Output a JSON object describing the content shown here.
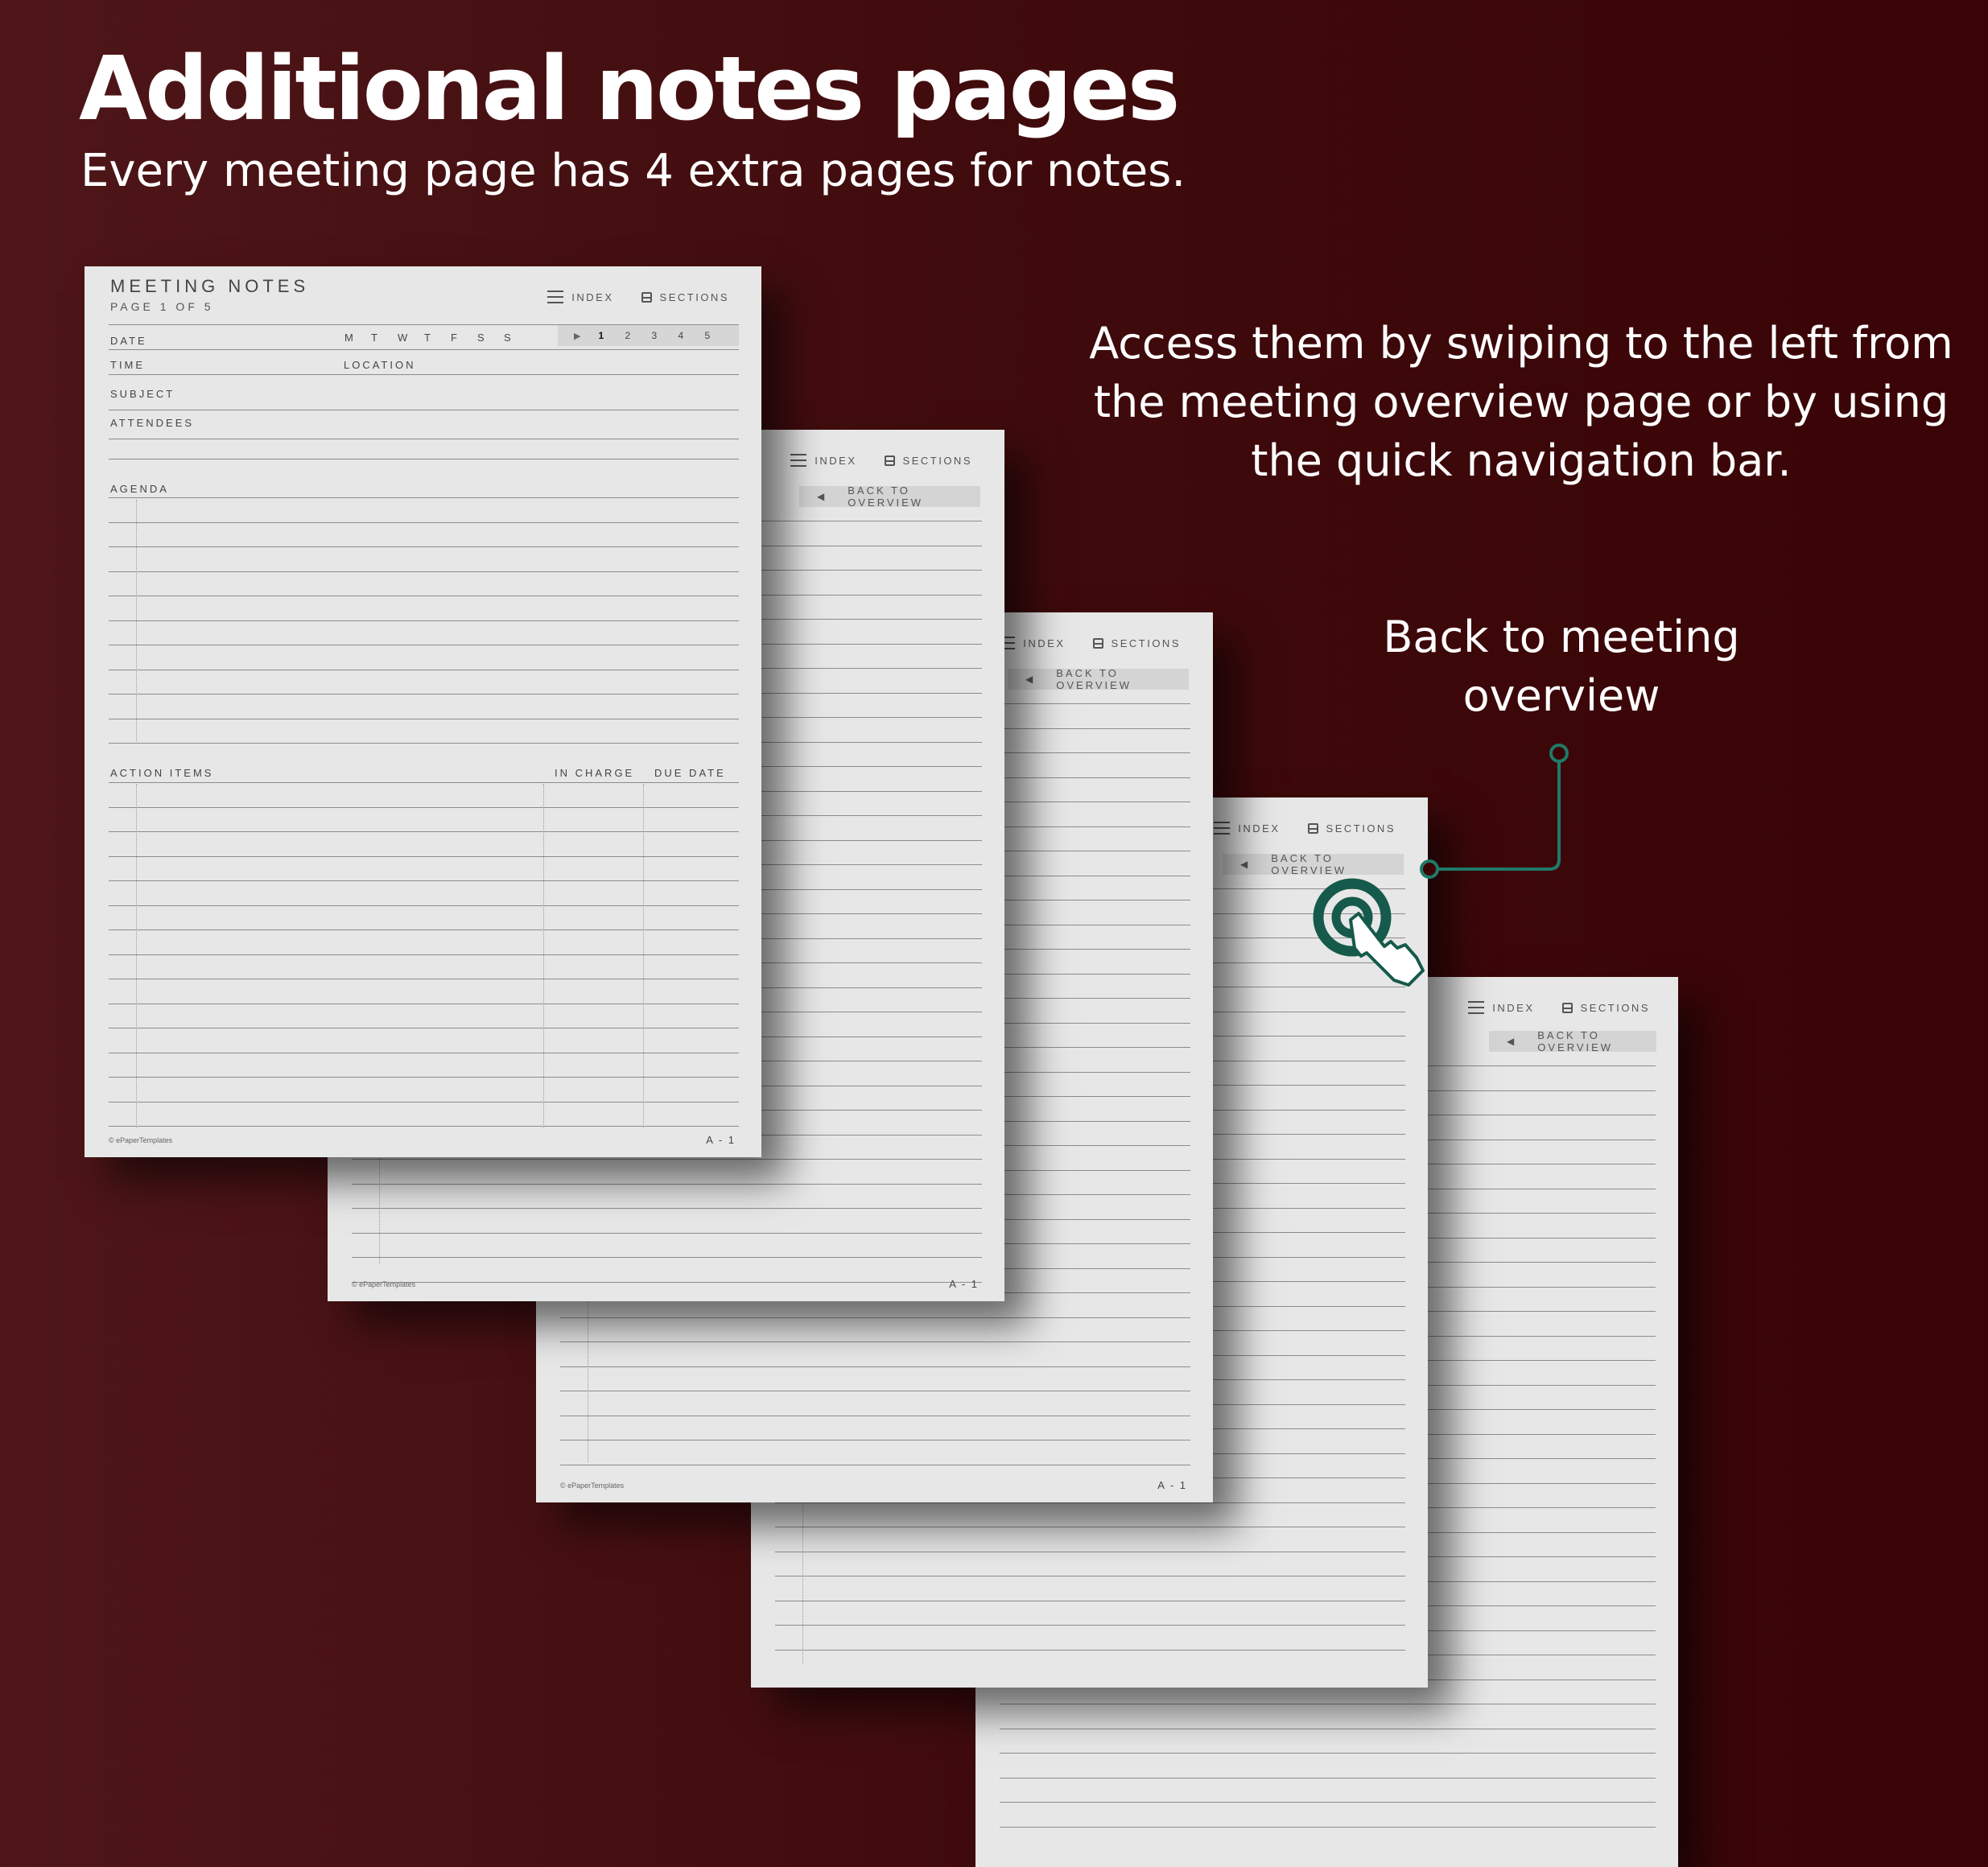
{
  "heading": {
    "title": "Additional notes pages",
    "subtitle": "Every meeting page has 4 extra pages for notes."
  },
  "callouts": {
    "swipe": "Access them by swiping to the left from the meeting overview page or by using the quick navigation bar.",
    "back": "Back to meeting overview"
  },
  "colors": {
    "background": "#4a1012",
    "accent": "#155a4a",
    "paper": "#e7e7e7"
  },
  "planner": {
    "title": "MEETING NOTES",
    "page_indicator": "PAGE 1 OF 5",
    "fields": {
      "date": "DATE",
      "time": "TIME",
      "location": "LOCATION",
      "subject": "SUBJECT",
      "attendees": "ATTENDEES",
      "agenda": "AGENDA",
      "action_items": "ACTION ITEMS",
      "in_charge": "IN CHARGE",
      "due_date": "DUE DATE"
    },
    "weekdays": [
      "M",
      "T",
      "W",
      "T",
      "F",
      "S",
      "S"
    ],
    "page_tabs": [
      "1",
      "2",
      "3",
      "4",
      "5"
    ],
    "active_page_tab": "1",
    "nav": {
      "index": "INDEX",
      "sections": "SECTIONS",
      "back_to_overview": "BACK TO OVERVIEW"
    },
    "footer": {
      "copyright": "© ePaperTemplates",
      "page_code": "A - 1"
    }
  },
  "icons": [
    "index-icon",
    "sections-icon",
    "back-arrow-icon",
    "next-arrow-icon",
    "tap-hand-icon"
  ]
}
